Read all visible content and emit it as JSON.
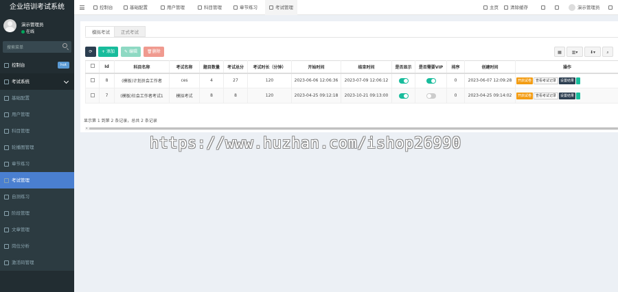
{
  "app": {
    "title": "企业培训考试系统"
  },
  "user": {
    "name": "演示管理员",
    "status": "在线"
  },
  "sidebar": {
    "search_placeholder": "搜索菜单",
    "items": [
      {
        "label": "控制台",
        "badge": "hot"
      },
      {
        "label": "考试系统"
      },
      {
        "label": "基础配置"
      },
      {
        "label": "用户管理"
      },
      {
        "label": "科目管理"
      },
      {
        "label": "轮播图管理"
      },
      {
        "label": "章节练习"
      },
      {
        "label": "考试管理"
      },
      {
        "label": "自测练习"
      },
      {
        "label": "阶段管理"
      },
      {
        "label": "文章管理"
      },
      {
        "label": "岗位分析"
      },
      {
        "label": "激活码管理"
      }
    ]
  },
  "topnav": {
    "items": [
      {
        "label": "控制台"
      },
      {
        "label": "基础配置"
      },
      {
        "label": "用户管理"
      },
      {
        "label": "科目管理"
      },
      {
        "label": "章节练习"
      },
      {
        "label": "考试管理"
      }
    ],
    "right": {
      "home": "主页",
      "clear_cache": "清除缓存",
      "user": "演示管理员"
    }
  },
  "tabs": [
    {
      "label": "模拟考试"
    },
    {
      "label": "正式考试"
    }
  ],
  "toolbar": {
    "add": "添加",
    "edit": "编辑",
    "delete": "删除"
  },
  "table": {
    "headers": [
      "",
      "Id",
      "科目名称",
      "考试名称",
      "题目数量",
      "考试总分",
      "考试时长（分钟）",
      "开始时间",
      "结束时间",
      "是否显示",
      "是否需要VIP",
      "排序",
      "创建时间",
      "操作"
    ],
    "rows": [
      {
        "id": "8",
        "subject": "(模板)计划员会工作者",
        "exam": "ces",
        "count": "4",
        "total": "27",
        "duration": "120",
        "start": "2023-06-06 12:06:36",
        "end": "2023-07-09 12:06:12",
        "show": true,
        "vip": true,
        "sort": "0",
        "created": "2023-06-07 12:09:28",
        "ops": [
          "开启试卷",
          "查看考试记录",
          "设置结果"
        ]
      },
      {
        "id": "7",
        "subject": "(模板)社会工作者考试1",
        "exam": "模拟考试",
        "count": "8",
        "total": "8",
        "duration": "120",
        "start": "2023-04-25 09:12:18",
        "end": "2023-10-21 09:13:00",
        "show": true,
        "vip": false,
        "sort": "0",
        "created": "2023-04-25 09:14:02",
        "ops": [
          "开启试卷",
          "查看考试记录",
          "设置结果"
        ]
      }
    ]
  },
  "pagination": {
    "info": "显示第 1 到第 2 条记录，总共 2 条记录"
  },
  "watermark": "https://www.huzhan.com/ishop26990",
  "colors": {
    "sidebar_bg": "#222d32",
    "active": "#4a7fd0",
    "success": "#18bc9c",
    "danger": "#f09a8f"
  }
}
